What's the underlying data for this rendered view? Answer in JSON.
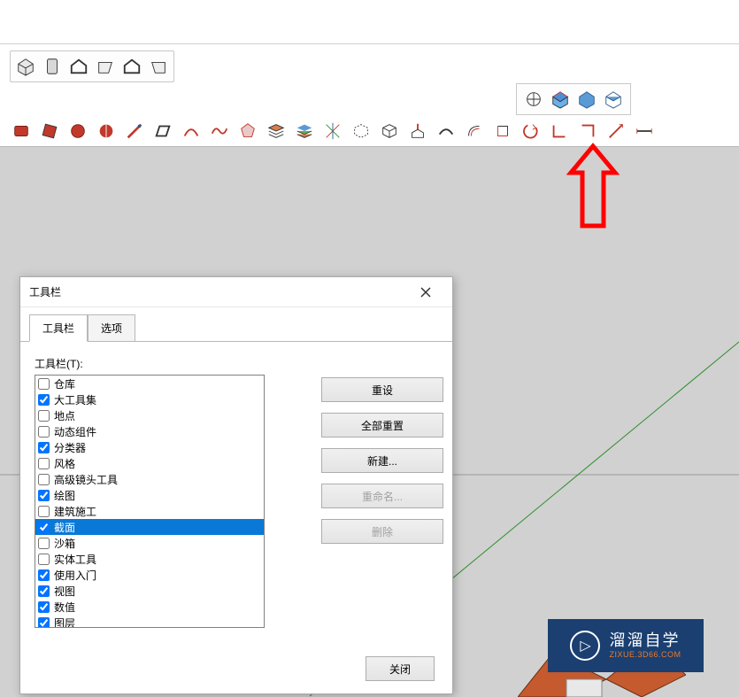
{
  "dialog": {
    "title": "工具栏",
    "tabs": [
      "工具栏",
      "选项"
    ],
    "list_label": "工具栏(T):",
    "items": [
      {
        "label": "仓库",
        "checked": false
      },
      {
        "label": "大工具集",
        "checked": true
      },
      {
        "label": "地点",
        "checked": false
      },
      {
        "label": "动态组件",
        "checked": false
      },
      {
        "label": "分类器",
        "checked": true
      },
      {
        "label": "风格",
        "checked": false
      },
      {
        "label": "高级镜头工具",
        "checked": false
      },
      {
        "label": "绘图",
        "checked": true
      },
      {
        "label": "建筑施工",
        "checked": false
      },
      {
        "label": "截面",
        "checked": true,
        "selected": true
      },
      {
        "label": "沙箱",
        "checked": false
      },
      {
        "label": "实体工具",
        "checked": false
      },
      {
        "label": "使用入门",
        "checked": true
      },
      {
        "label": "视图",
        "checked": true
      },
      {
        "label": "数值",
        "checked": true
      },
      {
        "label": "图层",
        "checked": true
      }
    ],
    "buttons": {
      "reset": "重设",
      "reset_all": "全部重置",
      "new": "新建...",
      "rename": "重命名...",
      "delete": "删除",
      "close": "关闭"
    }
  },
  "watermark": {
    "main": "溜溜自学",
    "sub": "ZIXUE.3D66.COM"
  },
  "colors": {
    "accent": "#0a78d6",
    "arrow": "#ff0000",
    "wm_bg": "#1a3f70",
    "wm_accent": "#e97b2e"
  }
}
